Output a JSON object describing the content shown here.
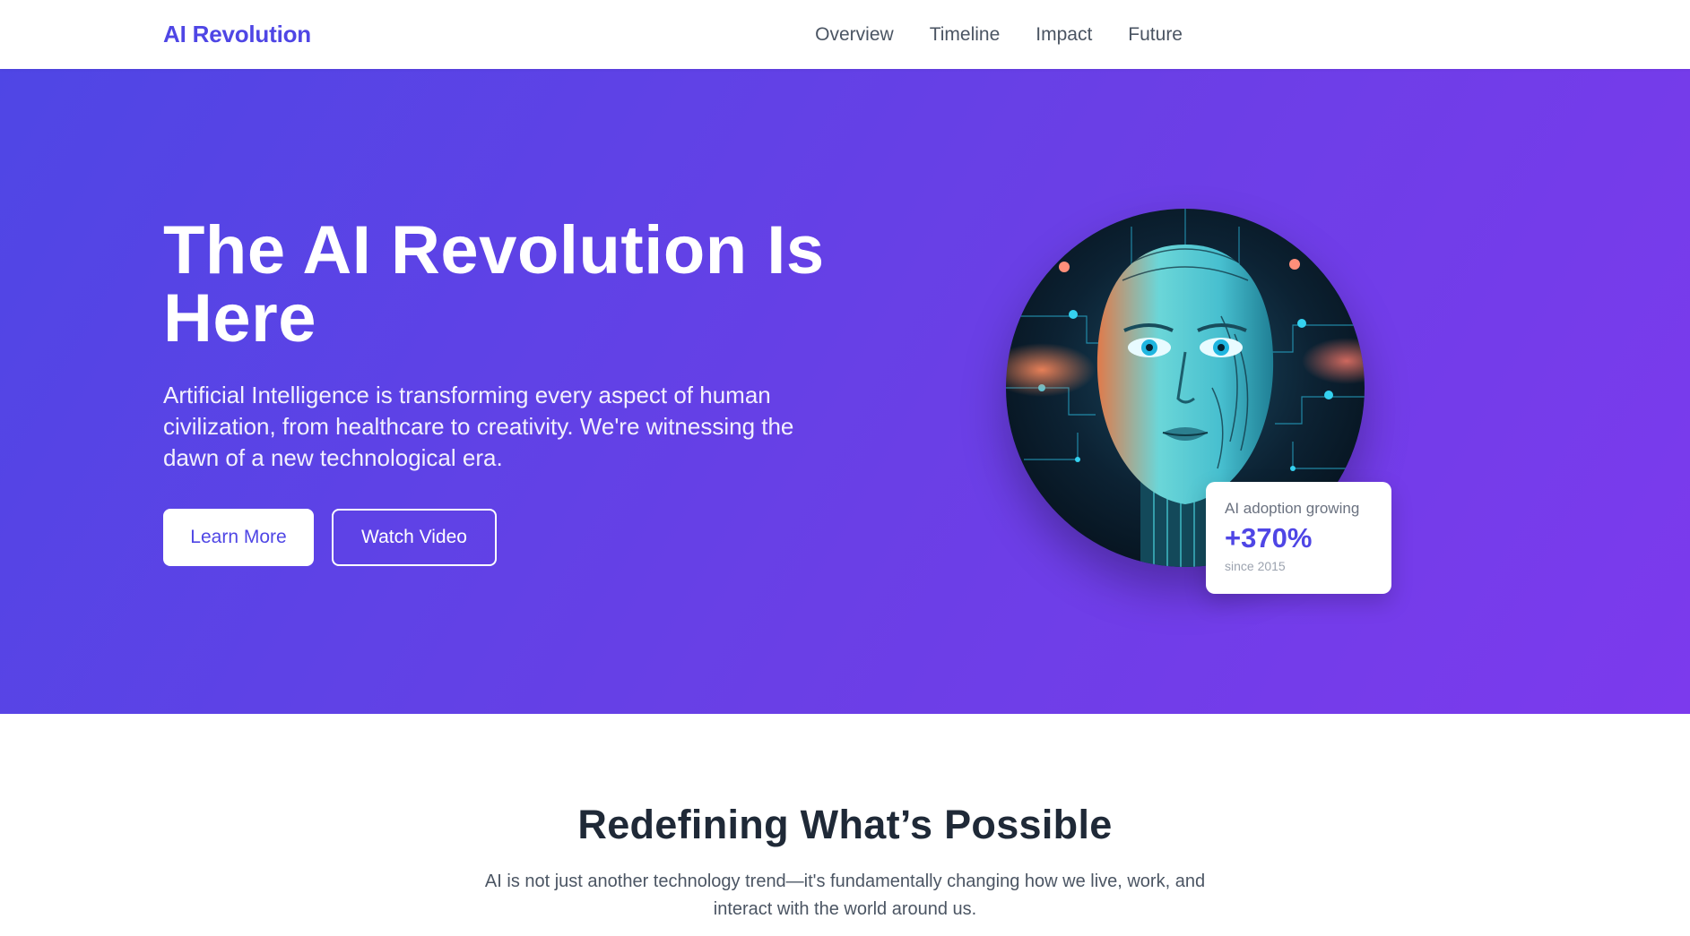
{
  "nav": {
    "brand": "AI Revolution",
    "links": [
      "Overview",
      "Timeline",
      "Impact",
      "Future"
    ]
  },
  "hero": {
    "title_line1": "The AI Revolution Is",
    "title_line2": "Here",
    "description": "Artificial Intelligence is transforming every aspect of human civilization, from healthcare to creativity. We're witnessing the dawn of a new technological era.",
    "buttons": {
      "primary": "Learn More",
      "secondary": "Watch Video"
    },
    "image_icon": "ai-face-portrait",
    "stat": {
      "label": "AI adoption growing",
      "value": "+370%",
      "sub": "since 2015"
    }
  },
  "section": {
    "title": "Redefining What’s Possible",
    "description": "AI is not just another technology trend—it's fundamentally changing how we live, work, and interact with the world around us."
  },
  "colors": {
    "brand": "#4f46e5",
    "hero_gradient_start": "#4f46e5",
    "hero_gradient_end": "#7c3aed"
  }
}
